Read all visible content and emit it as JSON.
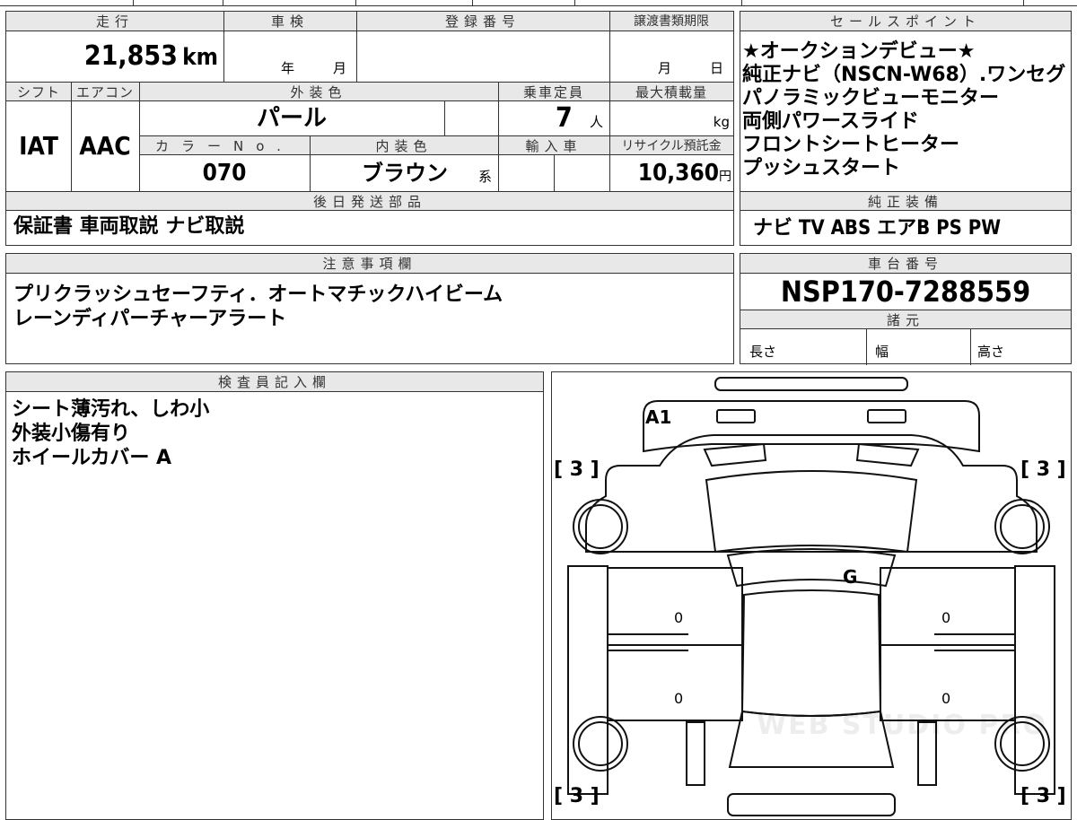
{
  "top_strip": {
    "cut_text_1": "",
    "cut_text_2": ""
  },
  "mileage": {
    "header": "走行",
    "value": "21,853",
    "unit": "km"
  },
  "inspection": {
    "header": "車検",
    "year_label": "年",
    "month_label": "月"
  },
  "registration": {
    "header": "登録番号",
    "value": ""
  },
  "transfer": {
    "header": "譲渡書類期限",
    "month_label": "月",
    "day_label": "日"
  },
  "shift": {
    "header": "シフト",
    "value": "IAT"
  },
  "aircon": {
    "header": "エアコン",
    "value": "AAC"
  },
  "exterior": {
    "header": "外装色",
    "value": "パール"
  },
  "capacity": {
    "header": "乗車定員",
    "value": "7",
    "unit": "人"
  },
  "max_load": {
    "header": "最大積載量",
    "unit": "kg"
  },
  "color_no": {
    "header": "カラーNo.",
    "value": "070"
  },
  "interior": {
    "header": "内装色",
    "value": "ブラウン",
    "suffix": "系"
  },
  "import": {
    "header": "輸入車"
  },
  "recycle": {
    "header": "リサイクル預託金",
    "value": "10,360",
    "unit": "円"
  },
  "later_parts": {
    "header": "後日発送部品",
    "value": "保証書 車両取説 ナビ取説"
  },
  "sales_points": {
    "header": "セールスポイント",
    "lines": [
      "★オークションデビュー★",
      "純正ナビ（NSCN-W68）.ワンセグ",
      "パノラミックビューモニター",
      "両側パワースライド",
      "フロントシートヒーター",
      "プッシュスタート"
    ]
  },
  "factory_equipment": {
    "header": "純正装備",
    "value": "ナビ TV ABS エアB PS PW"
  },
  "notes": {
    "header": "注意事項欄",
    "lines": [
      "プリクラッシュセーフティ．オートマチックハイビーム",
      "レーンディパーチャーアラート"
    ]
  },
  "chassis": {
    "header": "車台番号",
    "value": "NSP170-7288559"
  },
  "specs": {
    "header": "諸元",
    "length": "長さ",
    "width": "幅",
    "height": "高さ"
  },
  "inspector": {
    "header": "検査員記入欄",
    "lines": [
      "シート薄汚れ、しわ小",
      "外装小傷有り",
      "ホイールカバー A"
    ]
  },
  "diagram": {
    "tire_marks": [
      "[ 3 ]",
      "[ 3 ]",
      "[ 3 ]",
      "[ 3 ]"
    ],
    "damage_a1": "A1",
    "damage_g": "G",
    "zeros": [
      "0",
      "0",
      "0",
      "0"
    ],
    "watermark": "WEB STUDIO PRO"
  }
}
